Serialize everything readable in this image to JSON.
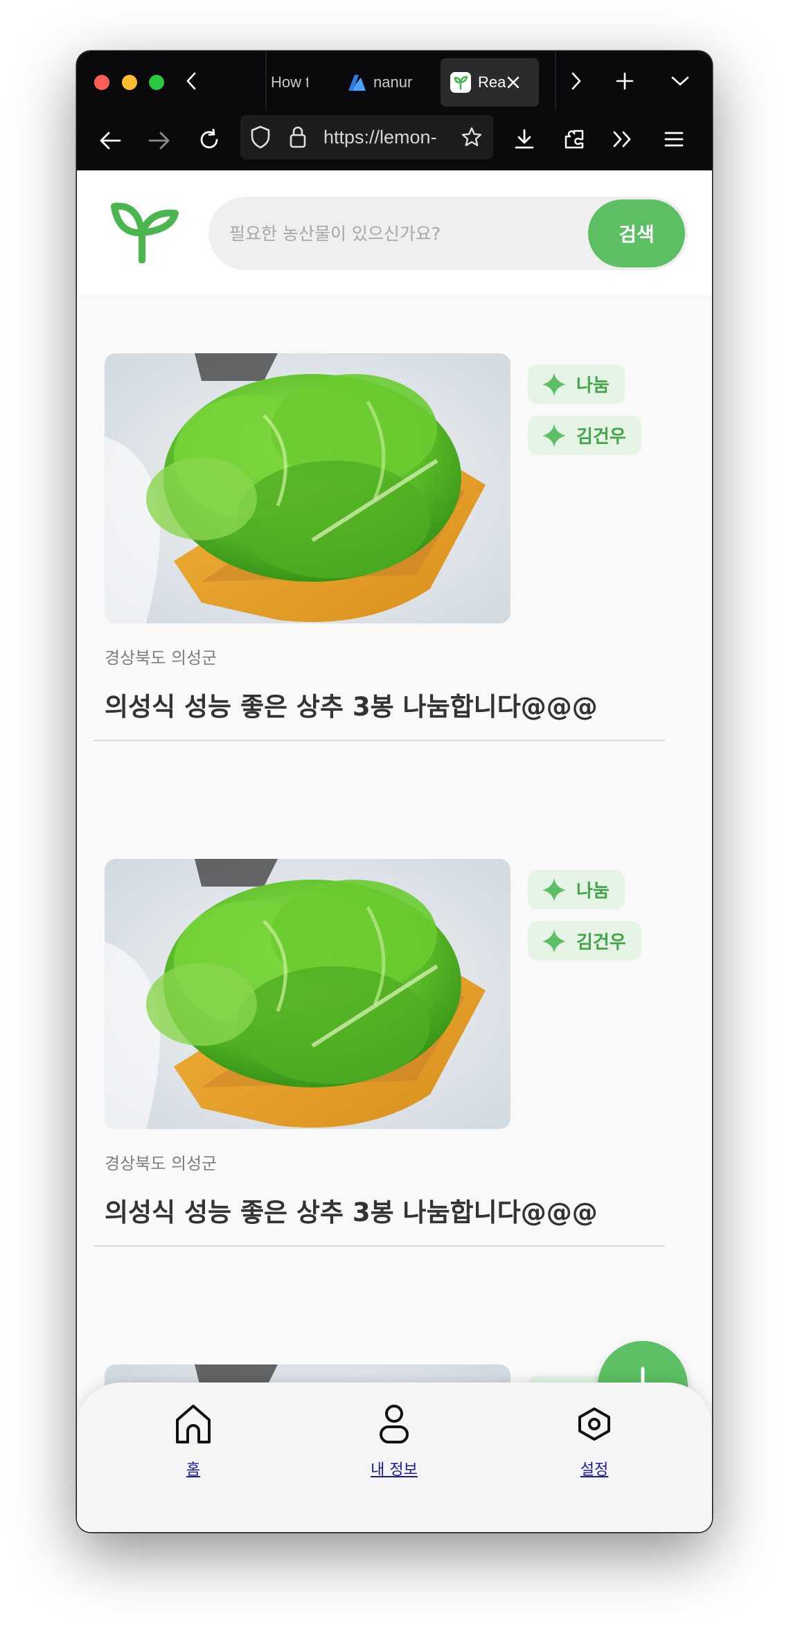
{
  "browser": {
    "tabs": [
      {
        "label": "How t",
        "active": false
      },
      {
        "label": "nanur",
        "active": false,
        "icon": "azure-icon"
      },
      {
        "label": "Rea",
        "active": true,
        "icon": "sprout-icon"
      }
    ],
    "url": "https://lemon-"
  },
  "app": {
    "search": {
      "placeholder": "필요한 농산물이 있으신가요?",
      "button_label": "검색"
    },
    "posts": [
      {
        "chips": [
          "나눔",
          "김건우"
        ],
        "region": "경상북도 의성군",
        "title": "의성식 성능 좋은 상추 3봉 나눔합니다@@@",
        "image": "lettuce-basket"
      },
      {
        "chips": [
          "나눔",
          "김건우"
        ],
        "region": "경상북도 의성군",
        "title": "의성식 성능 좋은 상추 3봉 나눔합니다@@@",
        "image": "lettuce-basket"
      },
      {
        "chips": [
          "",
          ""
        ],
        "region": "",
        "title": "",
        "image": "lettuce-basket"
      }
    ],
    "bottom_nav": [
      {
        "label": "홈",
        "icon": "home-icon"
      },
      {
        "label": "내 정보",
        "icon": "user-icon"
      },
      {
        "label": "설정",
        "icon": "settings-icon"
      }
    ],
    "colors": {
      "accent": "#5cbf63",
      "chip_bg": "#e6f4e6",
      "chip_text": "#44a44b"
    }
  }
}
